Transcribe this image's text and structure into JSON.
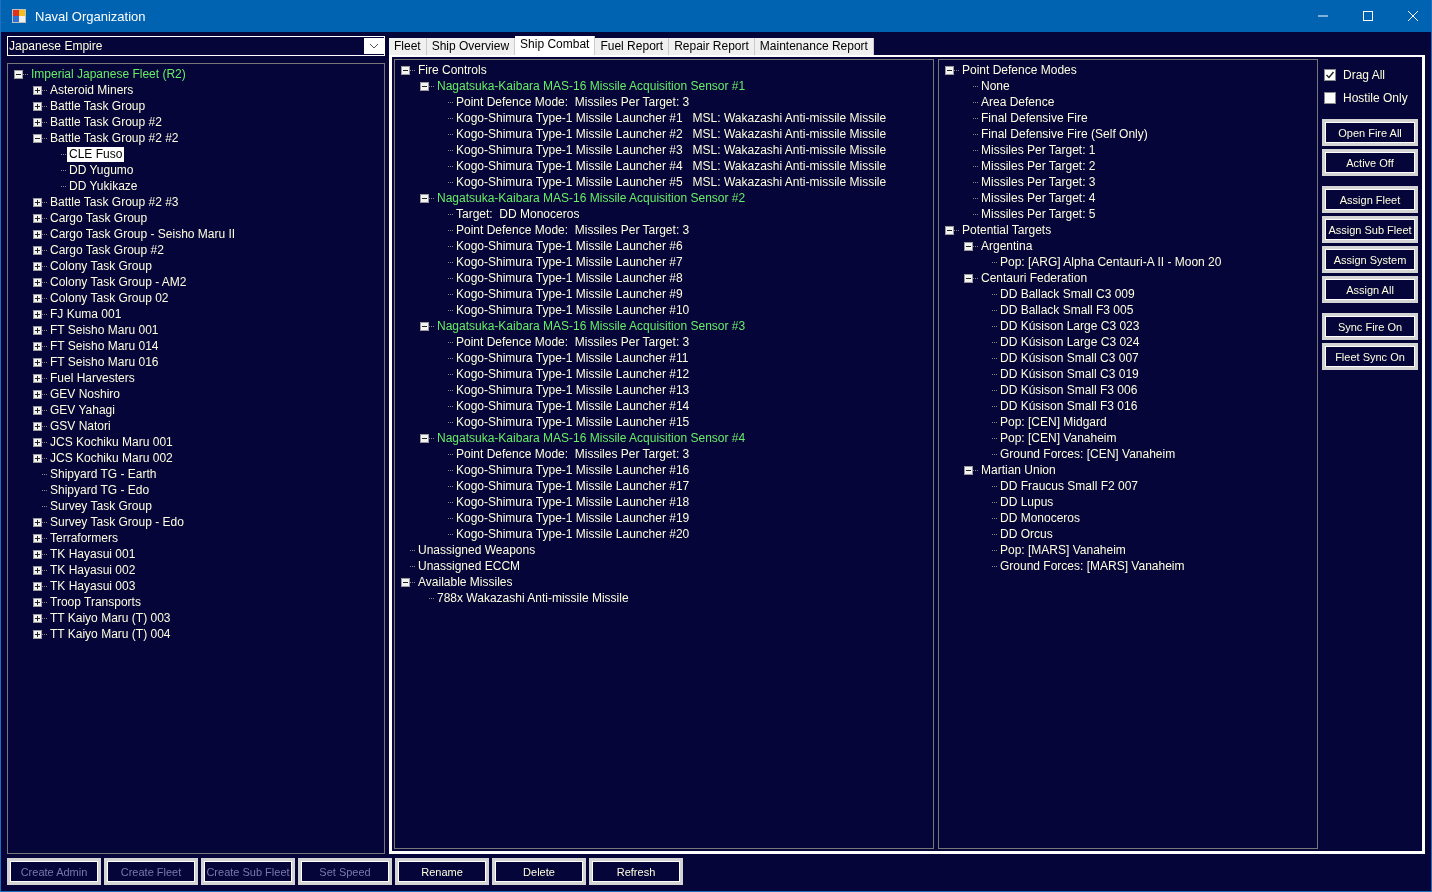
{
  "window": {
    "title": "Naval Organization"
  },
  "empire_select": {
    "value": "Japanese Empire"
  },
  "fleet_tree": [
    {
      "label": "Imperial Japanese Fleet  (R2)",
      "color": "#66ee66",
      "expanded": true,
      "selected": false,
      "children": [
        {
          "label": "Asteroid Miners",
          "expanded": false,
          "selected": false
        },
        {
          "label": "Battle Task Group",
          "expanded": false,
          "selected": false
        },
        {
          "label": "Battle Task Group #2",
          "expanded": false,
          "selected": false
        },
        {
          "label": "Battle Task Group #2 #2",
          "expanded": true,
          "selected": false,
          "children": [
            {
              "label": "CLE Fuso",
              "selected": true
            },
            {
              "label": "DD Yugumo",
              "selected": false
            },
            {
              "label": "DD Yukikaze",
              "selected": false
            }
          ]
        },
        {
          "label": "Battle Task Group #2 #3",
          "expanded": false,
          "selected": false
        },
        {
          "label": "Cargo Task Group",
          "expanded": false,
          "selected": false
        },
        {
          "label": "Cargo Task Group - Seisho Maru II",
          "expanded": false,
          "selected": false
        },
        {
          "label": "Cargo Task Group #2",
          "expanded": false,
          "selected": false
        },
        {
          "label": "Colony Task Group",
          "expanded": false,
          "selected": false
        },
        {
          "label": "Colony Task Group - AM2",
          "expanded": false,
          "selected": false
        },
        {
          "label": "Colony Task Group 02",
          "expanded": false,
          "selected": false
        },
        {
          "label": "FJ Kuma 001",
          "expanded": false,
          "selected": false
        },
        {
          "label": "FT Seisho Maru 001",
          "expanded": false,
          "selected": false
        },
        {
          "label": "FT Seisho Maru 014",
          "expanded": false,
          "selected": false
        },
        {
          "label": "FT Seisho Maru 016",
          "expanded": false,
          "selected": false
        },
        {
          "label": "Fuel Harvesters",
          "expanded": false,
          "selected": false
        },
        {
          "label": "GEV Noshiro",
          "expanded": false,
          "selected": false
        },
        {
          "label": "GEV Yahagi",
          "expanded": false,
          "selected": false
        },
        {
          "label": "GSV Natori",
          "expanded": false,
          "selected": false
        },
        {
          "label": "JCS Kochiku Maru 001",
          "expanded": false,
          "selected": false
        },
        {
          "label": "JCS Kochiku Maru 002",
          "expanded": false,
          "selected": false
        },
        {
          "label": "Shipyard TG - Earth",
          "selected": false
        },
        {
          "label": "Shipyard TG - Edo",
          "selected": false
        },
        {
          "label": "Survey Task Group",
          "selected": false
        },
        {
          "label": "Survey Task Group - Edo",
          "expanded": false,
          "selected": false
        },
        {
          "label": "Terraformers",
          "expanded": false,
          "selected": false
        },
        {
          "label": "TK Hayasui 001",
          "expanded": false,
          "selected": false
        },
        {
          "label": "TK Hayasui 002",
          "expanded": false,
          "selected": false
        },
        {
          "label": "TK Hayasui 003",
          "expanded": false,
          "selected": false
        },
        {
          "label": "Troop Transports",
          "expanded": false,
          "selected": false
        },
        {
          "label": "TT Kaiyo Maru (T) 003",
          "expanded": false,
          "selected": false
        },
        {
          "label": "TT Kaiyo Maru (T) 004",
          "expanded": false,
          "selected": false
        }
      ]
    }
  ],
  "tabs": [
    {
      "label": "Fleet",
      "selected": false
    },
    {
      "label": "Ship Overview",
      "selected": false
    },
    {
      "label": "Ship Combat",
      "selected": true
    },
    {
      "label": "Fuel Report",
      "selected": false
    },
    {
      "label": "Repair Report",
      "selected": false
    },
    {
      "label": "Maintenance Report",
      "selected": false
    }
  ],
  "fire_controls_tree": [
    {
      "label": "Fire Controls",
      "expanded": true,
      "children": [
        {
          "label": "Nagatsuka-Kaibara MAS-16 Missile Acquisition Sensor #1",
          "color": "#66ee66",
          "expanded": true,
          "children": [
            {
              "label": "Point Defence Mode:  Missiles Per Target: 3"
            },
            {
              "label": "Kogo-Shimura Type-1 Missile Launcher #1",
              "detail": "MSL: Wakazashi Anti-missile Missile"
            },
            {
              "label": "Kogo-Shimura Type-1 Missile Launcher #2",
              "detail": "MSL: Wakazashi Anti-missile Missile"
            },
            {
              "label": "Kogo-Shimura Type-1 Missile Launcher #3",
              "detail": "MSL: Wakazashi Anti-missile Missile"
            },
            {
              "label": "Kogo-Shimura Type-1 Missile Launcher #4",
              "detail": "MSL: Wakazashi Anti-missile Missile"
            },
            {
              "label": "Kogo-Shimura Type-1 Missile Launcher #5",
              "detail": "MSL: Wakazashi Anti-missile Missile"
            }
          ]
        },
        {
          "label": "Nagatsuka-Kaibara MAS-16 Missile Acquisition Sensor #2",
          "color": "#66ee66",
          "expanded": true,
          "children": [
            {
              "label": "Target:  DD Monoceros"
            },
            {
              "label": "Point Defence Mode:  Missiles Per Target: 3"
            },
            {
              "label": "Kogo-Shimura Type-1 Missile Launcher #6"
            },
            {
              "label": "Kogo-Shimura Type-1 Missile Launcher #7"
            },
            {
              "label": "Kogo-Shimura Type-1 Missile Launcher #8"
            },
            {
              "label": "Kogo-Shimura Type-1 Missile Launcher #9"
            },
            {
              "label": "Kogo-Shimura Type-1 Missile Launcher #10"
            }
          ]
        },
        {
          "label": "Nagatsuka-Kaibara MAS-16 Missile Acquisition Sensor #3",
          "color": "#66ee66",
          "expanded": true,
          "children": [
            {
              "label": "Point Defence Mode:  Missiles Per Target: 3"
            },
            {
              "label": "Kogo-Shimura Type-1 Missile Launcher #11"
            },
            {
              "label": "Kogo-Shimura Type-1 Missile Launcher #12"
            },
            {
              "label": "Kogo-Shimura Type-1 Missile Launcher #13"
            },
            {
              "label": "Kogo-Shimura Type-1 Missile Launcher #14"
            },
            {
              "label": "Kogo-Shimura Type-1 Missile Launcher #15"
            }
          ]
        },
        {
          "label": "Nagatsuka-Kaibara MAS-16 Missile Acquisition Sensor #4",
          "color": "#66ee66",
          "expanded": true,
          "children": [
            {
              "label": "Point Defence Mode:  Missiles Per Target: 3"
            },
            {
              "label": "Kogo-Shimura Type-1 Missile Launcher #16"
            },
            {
              "label": "Kogo-Shimura Type-1 Missile Launcher #17"
            },
            {
              "label": "Kogo-Shimura Type-1 Missile Launcher #18"
            },
            {
              "label": "Kogo-Shimura Type-1 Missile Launcher #19"
            },
            {
              "label": "Kogo-Shimura Type-1 Missile Launcher #20"
            }
          ]
        }
      ]
    },
    {
      "label": "Unassigned Weapons"
    },
    {
      "label": "Unassigned ECCM"
    },
    {
      "label": "Available Missiles",
      "expanded": true,
      "children": [
        {
          "label": "788x Wakazashi Anti-missile Missile"
        }
      ]
    }
  ],
  "targets_tree": [
    {
      "label": "Point Defence Modes",
      "expanded": true,
      "children": [
        {
          "label": "None"
        },
        {
          "label": "Area Defence"
        },
        {
          "label": "Final Defensive Fire"
        },
        {
          "label": "Final Defensive Fire (Self Only)"
        },
        {
          "label": "Missiles Per Target: 1"
        },
        {
          "label": "Missiles Per Target: 2"
        },
        {
          "label": "Missiles Per Target: 3"
        },
        {
          "label": "Missiles Per Target: 4"
        },
        {
          "label": "Missiles Per Target: 5"
        }
      ]
    },
    {
      "label": "Potential Targets",
      "expanded": true,
      "children": [
        {
          "label": "Argentina",
          "expanded": true,
          "children": [
            {
              "label": "Pop: [ARG] Alpha Centauri-A II - Moon 20"
            }
          ]
        },
        {
          "label": "Centauri Federation",
          "expanded": true,
          "children": [
            {
              "label": "DD Ballack Small C3 009"
            },
            {
              "label": "DD Ballack Small F3 005"
            },
            {
              "label": "DD Kúsison Large C3 023"
            },
            {
              "label": "DD Kúsison Large C3 024"
            },
            {
              "label": "DD Kúsison Small C3 007"
            },
            {
              "label": "DD Kúsison Small C3 019"
            },
            {
              "label": "DD Kúsison Small F3 006"
            },
            {
              "label": "DD Kúsison Small F3 016"
            },
            {
              "label": "Pop: [CEN] Midgard"
            },
            {
              "label": "Pop: [CEN] Vanaheim"
            },
            {
              "label": "Ground Forces: [CEN] Vanaheim"
            }
          ]
        },
        {
          "label": "Martian Union",
          "expanded": true,
          "children": [
            {
              "label": "DD Fraucus Small F2 007"
            },
            {
              "label": "DD Lupus"
            },
            {
              "label": "DD Monoceros"
            },
            {
              "label": "DD Orcus"
            },
            {
              "label": "Pop: [MARS] Vanaheim"
            },
            {
              "label": "Ground Forces: [MARS] Vanaheim"
            }
          ]
        }
      ]
    }
  ],
  "checkboxes": [
    {
      "label": "Drag All",
      "checked": true
    },
    {
      "label": "Hostile Only",
      "checked": false
    }
  ],
  "side_button_groups": [
    [
      "Open Fire All",
      "Active Off"
    ],
    [
      "Assign Fleet",
      "Assign Sub Fleet",
      "Assign System",
      "Assign All"
    ],
    [
      "Sync Fire On",
      "Fleet Sync On"
    ]
  ],
  "bottom_buttons": [
    {
      "label": "Create Admin",
      "disabled": true
    },
    {
      "label": "Create Fleet",
      "disabled": true
    },
    {
      "label": "Create Sub Fleet",
      "disabled": true
    },
    {
      "label": "Set Speed",
      "disabled": true
    },
    {
      "label": "Rename",
      "disabled": false
    },
    {
      "label": "Delete",
      "disabled": false
    },
    {
      "label": "Refresh",
      "disabled": false
    }
  ]
}
